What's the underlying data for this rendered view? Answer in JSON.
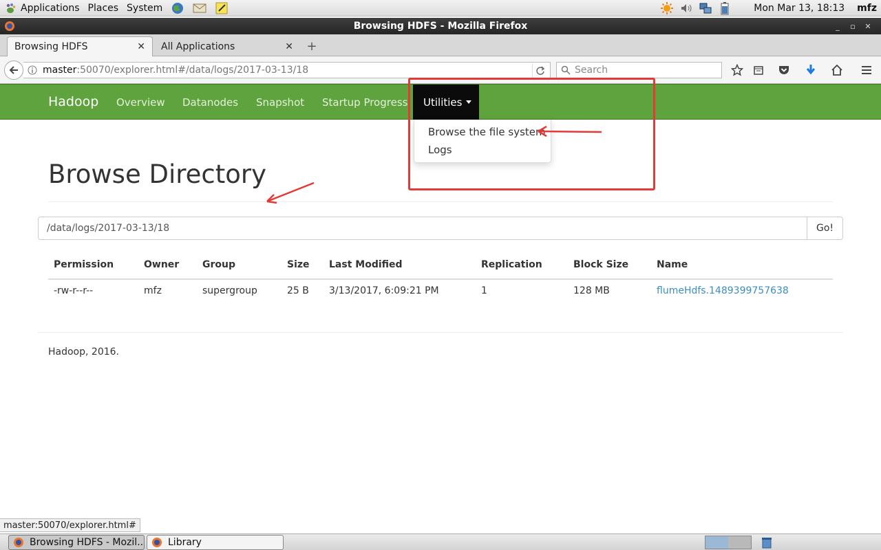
{
  "desktop": {
    "menus": [
      "Applications",
      "Places",
      "System"
    ],
    "clock": "Mon Mar 13, 18:13",
    "user": "mfz"
  },
  "window": {
    "title": "Browsing HDFS - Mozilla Firefox"
  },
  "tabs": [
    {
      "label": "Browsing HDFS",
      "active": true
    },
    {
      "label": "All Applications",
      "active": false
    }
  ],
  "urlbar": {
    "host": "master",
    "rest": ":50070/explorer.html#/data/logs/2017-03-13/18"
  },
  "search": {
    "placeholder": "Search"
  },
  "hadoop_nav": {
    "brand": "Hadoop",
    "items": [
      "Overview",
      "Datanodes",
      "Snapshot",
      "Startup Progress"
    ],
    "utilities": "Utilities",
    "dropdown": [
      "Browse the file system",
      "Logs"
    ]
  },
  "page": {
    "title": "Browse Directory",
    "path_value": "/data/logs/2017-03-13/18",
    "go_label": "Go!",
    "columns": [
      "Permission",
      "Owner",
      "Group",
      "Size",
      "Last Modified",
      "Replication",
      "Block Size",
      "Name"
    ],
    "rows": [
      [
        "-rw-r--r--",
        "mfz",
        "supergroup",
        "25 B",
        "3/13/2017, 6:09:21 PM",
        "1",
        "128 MB",
        "flumeHdfs.1489399757638"
      ]
    ],
    "footer": "Hadoop, 2016."
  },
  "status_text": "master:50070/explorer.html#",
  "taskbar": [
    {
      "label": "Browsing HDFS - Mozil...",
      "active": true
    },
    {
      "label": "Library",
      "active": false
    }
  ],
  "colors": {
    "hadoop_green": "#5fa33e",
    "annotation_red": "#e53935",
    "link": "#3a8ec4"
  }
}
